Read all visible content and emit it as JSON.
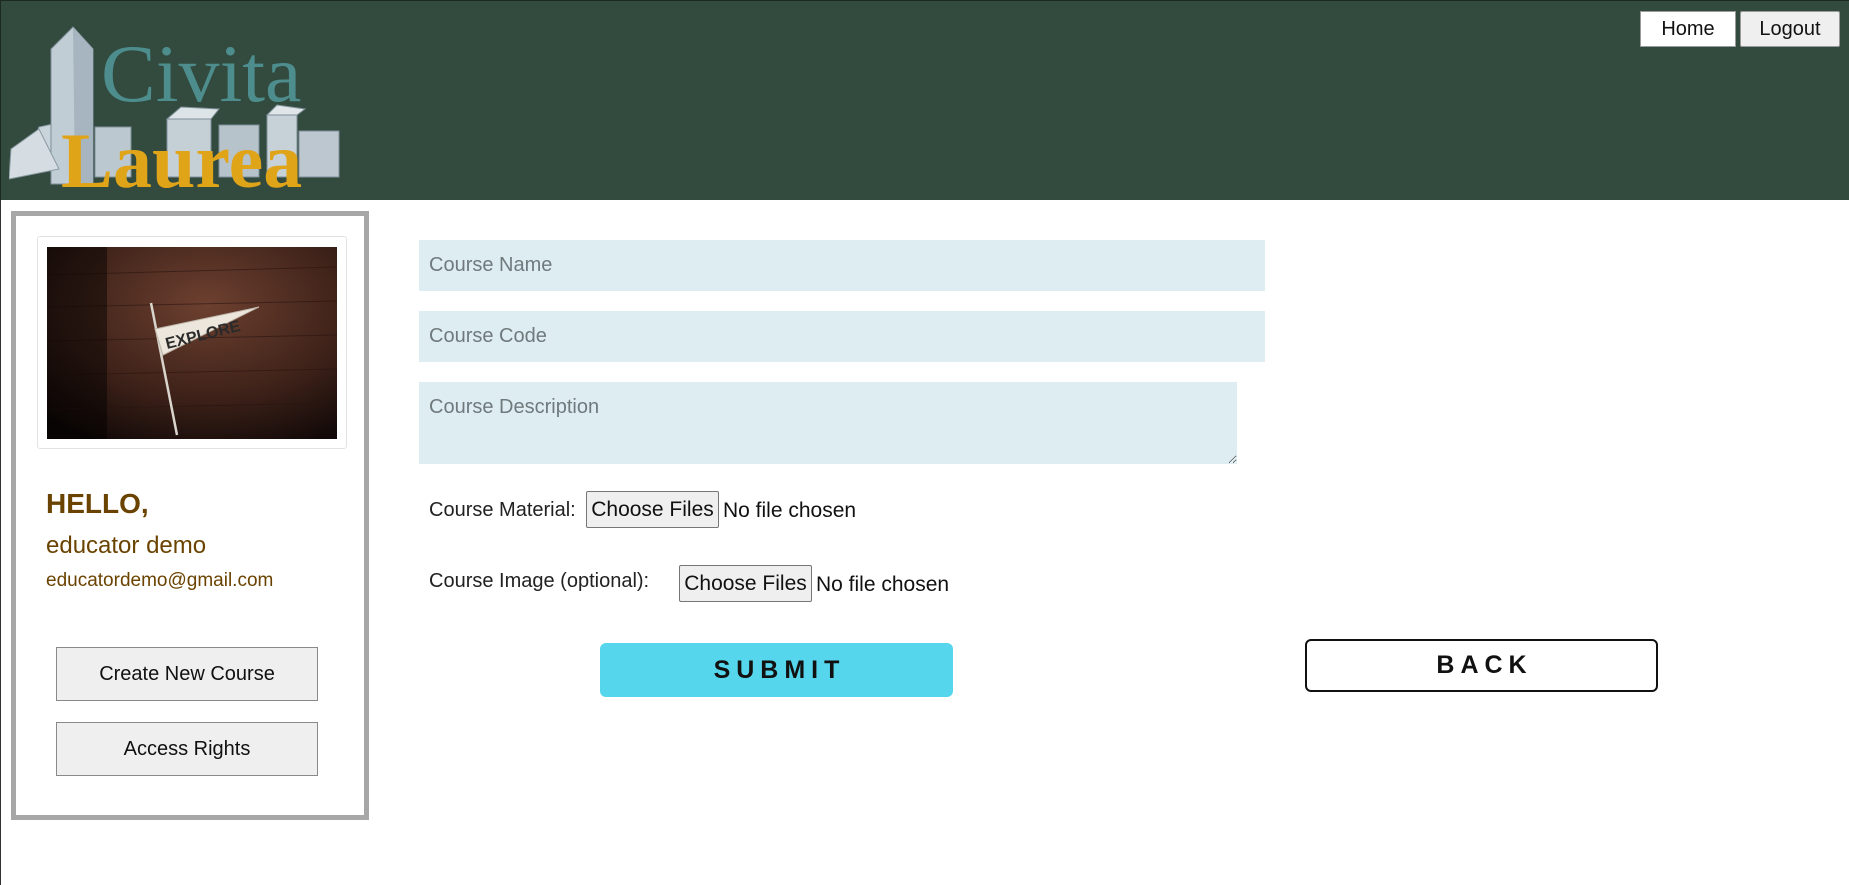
{
  "header": {
    "logo": {
      "line1": "Civita",
      "line2": "Laurea",
      "colors": {
        "civita": "#4e8d8d",
        "laurea": "#e0a419",
        "buildings": "#b8c4cc"
      }
    },
    "home_label": "Home",
    "logout_label": "Logout",
    "background_color": "#324b3e"
  },
  "sidebar": {
    "photo_text": "EXPLORE",
    "greeting": "HELLO,",
    "user_name": "educator demo",
    "user_email": "educatordemo@gmail.com",
    "create_course_label": "Create New Course",
    "access_rights_label": "Access Rights",
    "text_color": "#6b4300"
  },
  "form": {
    "course_name_placeholder": "Course Name",
    "course_code_placeholder": "Course Code",
    "course_description_placeholder": "Course Description",
    "course_material_label": "Course Material:",
    "course_image_label": "Course Image (optional):",
    "choose_files_label": "Choose Files",
    "no_file_text": "No file chosen",
    "field_background": "#deedf2"
  },
  "actions": {
    "submit_label": "SUBMIT",
    "back_label": "BACK",
    "submit_color": "#55d6ec"
  }
}
